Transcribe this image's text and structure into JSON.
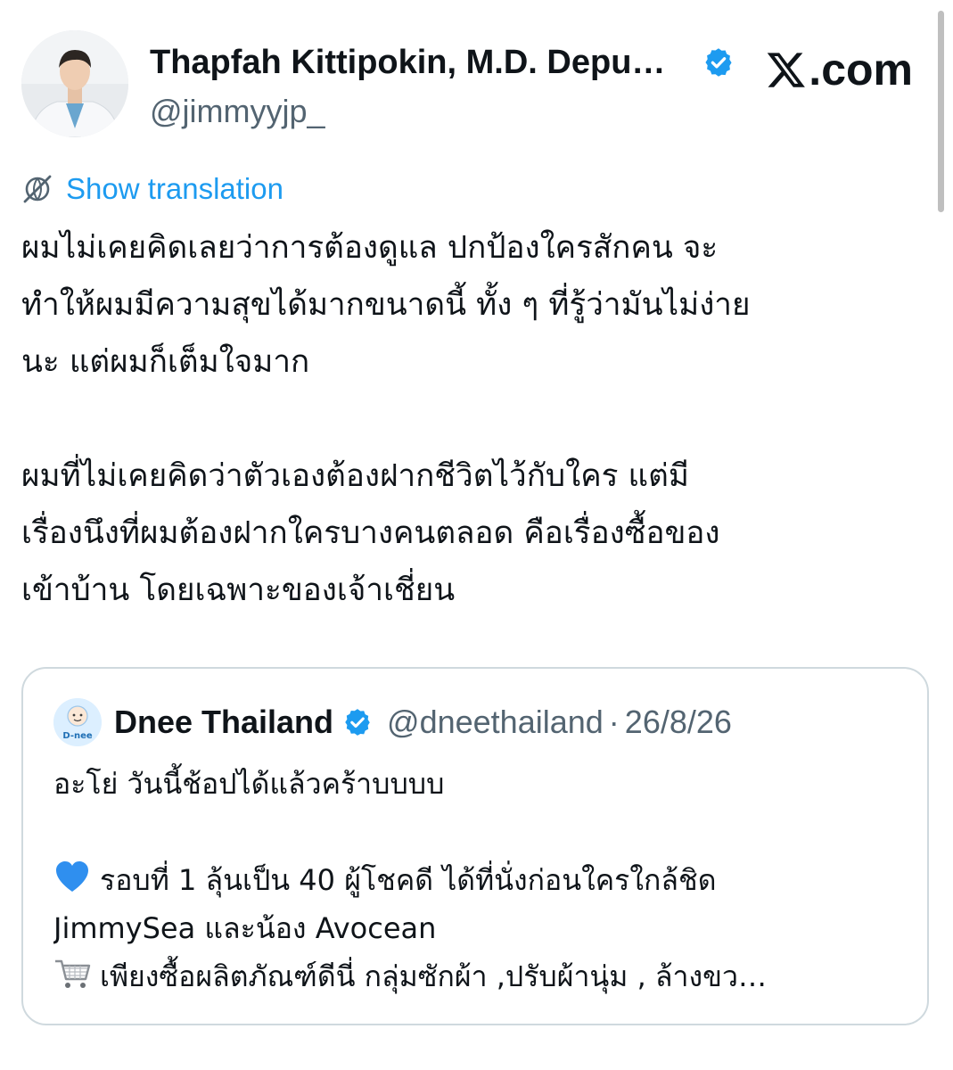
{
  "post": {
    "author": {
      "name": "Thapfah Kittipokin, M.D. Depu…",
      "handle": "@jimmyyjp_",
      "verified": true
    },
    "brand": {
      "site": ".com",
      "icon": "x-logo-icon"
    },
    "translation": {
      "icon": "translate-icon",
      "label": "Show translation"
    },
    "body": {
      "paragraph1": [
        "ผมไม่เคยคิดเลยว่าการต้องดูแล ปกป้องใครสักคน จะ",
        "ทำให้ผมมีความสุขได้มากขนาดนี้ ทั้ง ๆ ที่รู้ว่ามันไม่ง่าย",
        "นะ แต่ผมก็เต็มใจมาก"
      ],
      "paragraph2": [
        "ผมที่ไม่เคยคิดว่าตัวเองต้องฝากชีวิตไว้กับใคร แต่มี",
        "เรื่องนึงที่ผมต้องฝากใครบางคนตลอด คือเรื่องซื้อของ",
        "เข้าบ้าน โดยเฉพาะของเจ้าเชี่ยน"
      ]
    },
    "quote": {
      "avatar_text": "D-nee",
      "name": "Dnee Thailand",
      "verified": true,
      "handle": "@dneethailand",
      "separator": "·",
      "date": "26/8/26",
      "line1": "อะโย่ วันนี้ช้อปได้แล้วคร้าบบบบ",
      "line2": "รอบที่ 1 ลุ้นเป็น 40 ผู้โชคดี ได้ที่นั่งก่อนใครใกล้ชิด",
      "line2_icon": "blue-heart-icon",
      "line3": "JimmySea และน้อง Avocean",
      "line4": "เพียงซื้อผลิตภัณฑ์ดีนี่ กลุ่มซักผ้า ,ปรับผ้านุ่ม , ล้างขว…",
      "line4_icon": "shopping-cart-icon"
    },
    "colors": {
      "link": "#1d9bf0",
      "secondary_text": "#536471",
      "border": "#cfd9de",
      "verified": "#1d9bf0"
    }
  }
}
